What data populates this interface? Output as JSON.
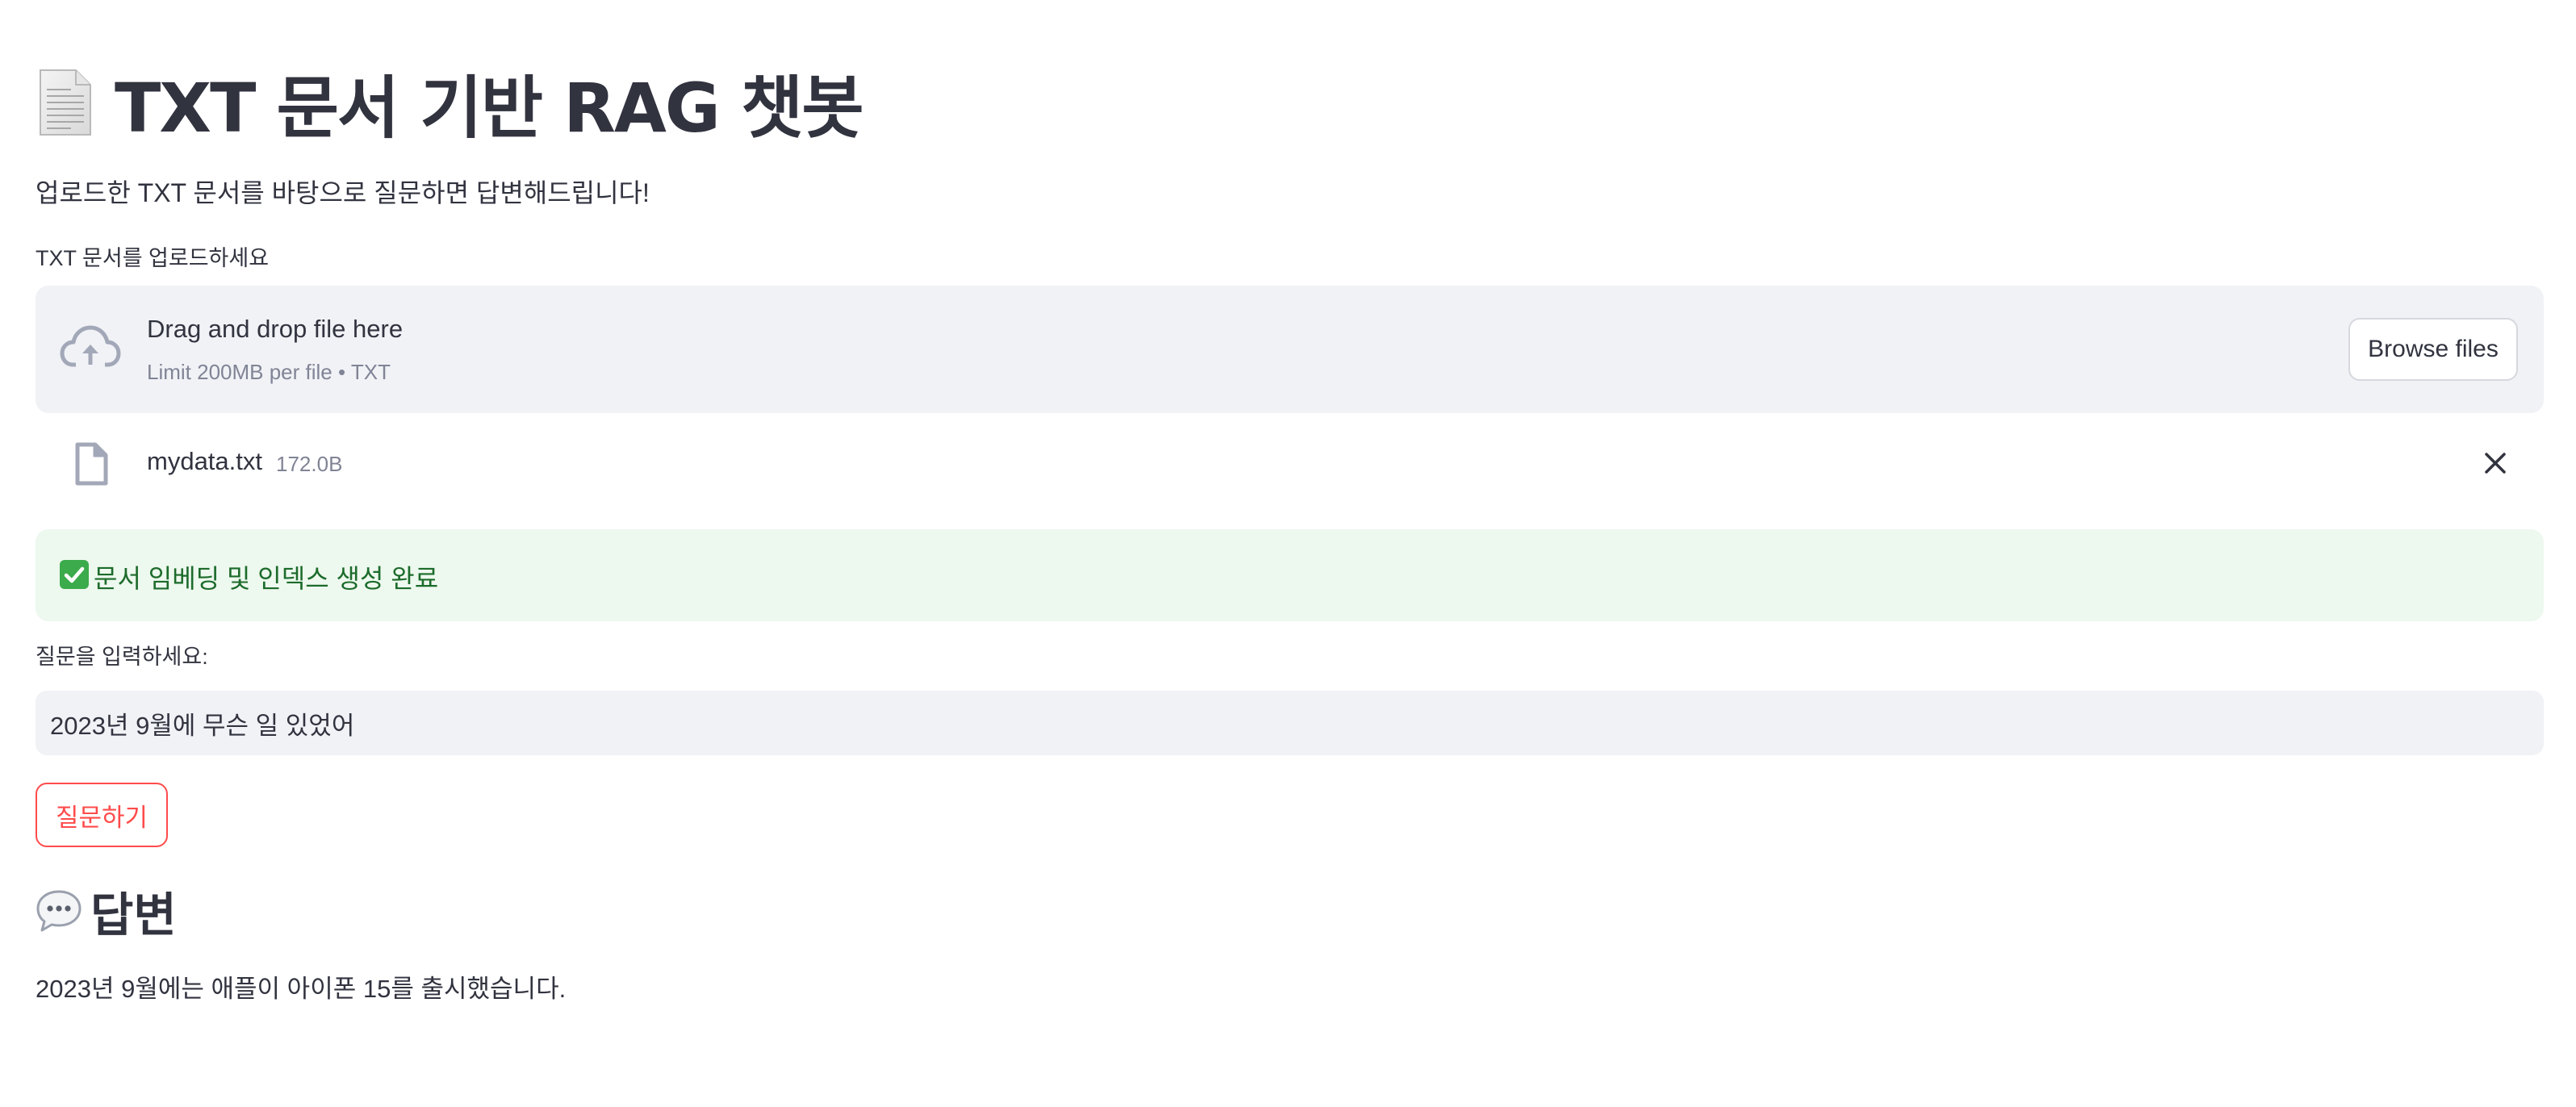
{
  "header": {
    "title_icon": "page-facing-up-icon",
    "title": "TXT 문서 기반 RAG 챗봇",
    "subtitle": "업로드한 TXT 문서를 바탕으로 질문하면 답변해드립니다!"
  },
  "uploader": {
    "label": "TXT 문서를 업로드하세요",
    "dropzone_icon": "cloud-upload-icon",
    "dropzone_text": "Drag and drop file here",
    "limit_text": "Limit 200MB per file • TXT",
    "browse_label": "Browse files"
  },
  "uploaded_file": {
    "icon": "file-icon",
    "name": "mydata.txt",
    "size": "172.0B",
    "remove_icon": "close-icon"
  },
  "status": {
    "icon": "check-mark-icon",
    "text": "문서 임베딩 및 인덱스 생성 완료",
    "color": "#1c6b2b"
  },
  "question": {
    "label": "질문을 입력하세요:",
    "value": "2023년 9월에 무슨 일 있었어"
  },
  "ask_button": {
    "label": "질문하기",
    "color": "#ff4b4b"
  },
  "answer": {
    "icon": "speech-balloon-icon",
    "title": "답변",
    "text": "2023년 9월에는 애플이 아이폰 15를 출시했습니다."
  }
}
